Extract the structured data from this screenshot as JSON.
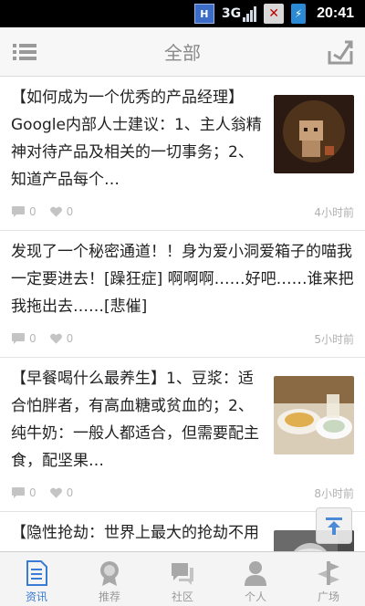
{
  "status_bar": {
    "network_h": "H",
    "network_type": "3G",
    "time": "20:41"
  },
  "header": {
    "title": "全部",
    "left_icon": "list-menu-icon",
    "right_icon": "share-tray-icon"
  },
  "feed": [
    {
      "text": "【如何成为一个优秀的产品经理】Google内部人士建议：1、主人翁精神对待产品及相关的一切事务；2、知道产品每个…",
      "comments": "0",
      "likes": "0",
      "time": "4小时前",
      "has_image": true
    },
    {
      "text": "发现了一个秘密通道！！身为爱小洞爱箱子的喵我一定要进去！[躁狂症] 啊啊啊……好吧……谁来把我拖出去……[悲催]",
      "comments": "0",
      "likes": "0",
      "time": "5小时前",
      "has_image": false
    },
    {
      "text": "【早餐喝什么最养生】1、豆浆：适合怕胖者，有高血糖或贫血的；2、纯牛奶：一般人都适合，但需要配主食，配坚果…",
      "comments": "0",
      "likes": "0",
      "time": "8小时前",
      "has_image": true
    },
    {
      "text": "【隐性抢劫：世界上最大的抢劫不用刀枪，乃用货币】吴敬…",
      "comments": "",
      "likes": "",
      "time": "",
      "has_image": true
    }
  ],
  "tabs": [
    {
      "label": "资讯",
      "icon": "news-icon",
      "active": true
    },
    {
      "label": "推荐",
      "icon": "recommend-badge-icon",
      "active": false
    },
    {
      "label": "社区",
      "icon": "community-chat-icon",
      "active": false
    },
    {
      "label": "个人",
      "icon": "person-icon",
      "active": false
    },
    {
      "label": "广场",
      "icon": "plaza-icon",
      "active": false
    }
  ],
  "colors": {
    "accent": "#3a7bd5",
    "muted": "#b8b8b8",
    "text": "#222222"
  }
}
